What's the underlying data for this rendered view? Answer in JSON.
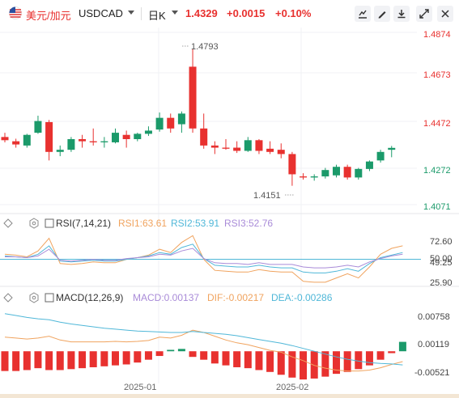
{
  "header": {
    "symbol_cn": "美元/加元",
    "symbol_en": "USDCAD",
    "timeframe": "日K",
    "last_price": "1.4329",
    "change": "+0.0015",
    "change_pct": "+0.10%",
    "icons": [
      "chart-settings-icon",
      "pen-icon",
      "save-icon",
      "expand-icon",
      "close-icon"
    ]
  },
  "colors": {
    "up": "#1b9a6a",
    "down": "#e8312f",
    "rsi1": "#f0a35e",
    "rsi2": "#4fb7d8",
    "rsi3": "#a98bd8",
    "dif": "#f0a35e",
    "dea": "#4fb7d8"
  },
  "chart_data": [
    {
      "type": "candlestick",
      "ylim": [
        1.4051,
        1.4894
      ],
      "y_ticks": [
        "1.4874",
        "1.4673",
        "1.4472",
        "1.4272",
        "1.4071"
      ],
      "x_ticks": [
        "2025-01",
        "2025-02"
      ],
      "annotations": {
        "max": "1.4793",
        "min": "1.4151"
      },
      "candles": [
        {
          "o": 1.438,
          "h": 1.44,
          "l": 1.4355,
          "c": 1.4365
        },
        {
          "o": 1.436,
          "h": 1.4372,
          "l": 1.433,
          "c": 1.4345
        },
        {
          "o": 1.434,
          "h": 1.4395,
          "l": 1.433,
          "c": 1.439
        },
        {
          "o": 1.44,
          "h": 1.448,
          "l": 1.4395,
          "c": 1.4455
        },
        {
          "o": 1.445,
          "h": 1.446,
          "l": 1.427,
          "c": 1.431
        },
        {
          "o": 1.431,
          "h": 1.434,
          "l": 1.429,
          "c": 1.432
        },
        {
          "o": 1.432,
          "h": 1.438,
          "l": 1.431,
          "c": 1.437
        },
        {
          "o": 1.437,
          "h": 1.439,
          "l": 1.433,
          "c": 1.436
        },
        {
          "o": 1.436,
          "h": 1.442,
          "l": 1.434,
          "c": 1.4355
        },
        {
          "o": 1.4355,
          "h": 1.438,
          "l": 1.433,
          "c": 1.436
        },
        {
          "o": 1.4355,
          "h": 1.442,
          "l": 1.435,
          "c": 1.44
        },
        {
          "o": 1.439,
          "h": 1.441,
          "l": 1.433,
          "c": 1.437
        },
        {
          "o": 1.437,
          "h": 1.44,
          "l": 1.436,
          "c": 1.4395
        },
        {
          "o": 1.4395,
          "h": 1.443,
          "l": 1.4385,
          "c": 1.441
        },
        {
          "o": 1.4415,
          "h": 1.4495,
          "l": 1.4405,
          "c": 1.447
        },
        {
          "o": 1.447,
          "h": 1.449,
          "l": 1.44,
          "c": 1.442
        },
        {
          "o": 1.444,
          "h": 1.45,
          "l": 1.44,
          "c": 1.449
        },
        {
          "o": 1.471,
          "h": 1.4793,
          "l": 1.44,
          "c": 1.442
        },
        {
          "o": 1.442,
          "h": 1.449,
          "l": 1.4325,
          "c": 1.434
        },
        {
          "o": 1.434,
          "h": 1.436,
          "l": 1.43,
          "c": 1.433
        },
        {
          "o": 1.433,
          "h": 1.437,
          "l": 1.432,
          "c": 1.4325
        },
        {
          "o": 1.433,
          "h": 1.436,
          "l": 1.4305,
          "c": 1.4315
        },
        {
          "o": 1.4315,
          "h": 1.438,
          "l": 1.431,
          "c": 1.4365
        },
        {
          "o": 1.4365,
          "h": 1.437,
          "l": 1.43,
          "c": 1.4315
        },
        {
          "o": 1.4325,
          "h": 1.436,
          "l": 1.43,
          "c": 1.431
        },
        {
          "o": 1.432,
          "h": 1.435,
          "l": 1.428,
          "c": 1.43
        },
        {
          "o": 1.43,
          "h": 1.431,
          "l": 1.4151,
          "c": 1.4205
        },
        {
          "o": 1.4195,
          "h": 1.421,
          "l": 1.418,
          "c": 1.419
        },
        {
          "o": 1.419,
          "h": 1.4205,
          "l": 1.4175,
          "c": 1.4195
        },
        {
          "o": 1.4195,
          "h": 1.4235,
          "l": 1.4185,
          "c": 1.4225
        },
        {
          "o": 1.42,
          "h": 1.425,
          "l": 1.419,
          "c": 1.424
        },
        {
          "o": 1.424,
          "h": 1.425,
          "l": 1.418,
          "c": 1.419
        },
        {
          "o": 1.419,
          "h": 1.4235,
          "l": 1.418,
          "c": 1.423
        },
        {
          "o": 1.423,
          "h": 1.427,
          "l": 1.422,
          "c": 1.4265
        },
        {
          "o": 1.427,
          "h": 1.432,
          "l": 1.426,
          "c": 1.431
        },
        {
          "o": 1.432,
          "h": 1.4338,
          "l": 1.4285,
          "c": 1.4329
        }
      ]
    },
    {
      "type": "line",
      "title": "RSI(7,14,21)",
      "legend": [
        "RSI1:63.61",
        "RSI2:53.91",
        "RSI3:52.76"
      ],
      "ylim": [
        20,
        85
      ],
      "y_ticks": [
        "72.60",
        "50.00",
        "49.25",
        "25.90"
      ],
      "reference_line": 50,
      "series": [
        {
          "name": "RSI1",
          "values": [
            56,
            55,
            53,
            60,
            75,
            45,
            44,
            45,
            47,
            46,
            46,
            50,
            52,
            55,
            62,
            58,
            70,
            78,
            50,
            37,
            36,
            35,
            35,
            38,
            36,
            35,
            35,
            24,
            23,
            23,
            28,
            33,
            28,
            41,
            56,
            63,
            66
          ]
        },
        {
          "name": "RSI2",
          "values": [
            54,
            53,
            52,
            56,
            66,
            48,
            47,
            48,
            49,
            48,
            48,
            50,
            52,
            54,
            58,
            56,
            64,
            68,
            51,
            43,
            42,
            41,
            41,
            43,
            41,
            40,
            40,
            35,
            34,
            34,
            36,
            39,
            36,
            45,
            52,
            55,
            58
          ]
        },
        {
          "name": "RSI3",
          "values": [
            53,
            53,
            52,
            54,
            62,
            49,
            48,
            49,
            50,
            49,
            49,
            51,
            52,
            53,
            56,
            55,
            60,
            63,
            51,
            46,
            45,
            45,
            44,
            46,
            44,
            44,
            44,
            41,
            40,
            40,
            41,
            43,
            41,
            47,
            51,
            54,
            56
          ]
        }
      ]
    },
    {
      "type": "bar",
      "title": "MACD(12,26,9)",
      "legend": [
        "MACD:0.00137",
        "DIF:-0.00217",
        "DEA:-0.00286"
      ],
      "ylim": [
        -0.0065,
        0.0095
      ],
      "y_ticks": [
        "0.00758",
        "0.00119",
        "-0.00521"
      ],
      "macd_hist": [
        -0.0042,
        -0.0042,
        -0.004,
        -0.0036,
        -0.004,
        -0.004,
        -0.0038,
        -0.0036,
        -0.0034,
        -0.0032,
        -0.003,
        -0.0028,
        -0.0024,
        -0.0018,
        -0.001,
        0.0003,
        0.0005,
        -0.0012,
        -0.0018,
        -0.0026,
        -0.003,
        -0.0034,
        -0.0036,
        -0.004,
        -0.0044,
        -0.005,
        -0.0056,
        -0.006,
        -0.0058,
        -0.0054,
        -0.0048,
        -0.0044,
        -0.0038,
        -0.003,
        -0.0018,
        -0.0004,
        0.002
      ],
      "series": [
        {
          "name": "DIF",
          "values": [
            0.003,
            0.0028,
            0.0026,
            0.0028,
            0.0032,
            0.0024,
            0.002,
            0.002,
            0.002,
            0.002,
            0.0021,
            0.002,
            0.0021,
            0.0023,
            0.003,
            0.0028,
            0.0034,
            0.0045,
            0.004,
            0.0032,
            0.0024,
            0.0018,
            0.0014,
            0.0008,
            0.0002,
            -0.0002,
            -0.0012,
            -0.002,
            -0.003,
            -0.0036,
            -0.004,
            -0.0042,
            -0.0042,
            -0.004,
            -0.0035,
            -0.0028,
            -0.0022
          ]
        },
        {
          "name": "DEA",
          "values": [
            0.008,
            0.0076,
            0.0072,
            0.0069,
            0.0067,
            0.0062,
            0.0058,
            0.0055,
            0.0052,
            0.0049,
            0.0047,
            0.0045,
            0.0043,
            0.0042,
            0.0041,
            0.004,
            0.004,
            0.0042,
            0.004,
            0.0038,
            0.0036,
            0.0033,
            0.0029,
            0.0025,
            0.0021,
            0.0017,
            0.0012,
            0.0006,
            0.0,
            -0.0006,
            -0.0012,
            -0.0017,
            -0.0021,
            -0.0024,
            -0.0026,
            -0.0027,
            -0.0029
          ]
        }
      ]
    }
  ]
}
